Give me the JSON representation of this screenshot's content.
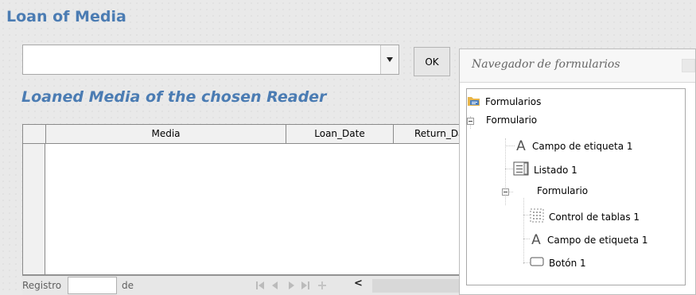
{
  "form": {
    "title": "Loan of Media",
    "ok_label": "OK",
    "subtitle": "Loaned Media of the chosen Reader"
  },
  "grid": {
    "columns": [
      "Media",
      "Loan_Date",
      "Return_Da"
    ]
  },
  "navigation": {
    "record_label": "Registro",
    "of_label": "de",
    "scroll_left_glyph": "<"
  },
  "navigator": {
    "title": "Navegador de formularios",
    "tree": [
      {
        "label": "Formularios",
        "icon": "forms-folder-icon",
        "level": 0
      },
      {
        "label": "Formulario",
        "icon": "expander-icon",
        "level": 0
      },
      {
        "label": "Campo de etiqueta 1",
        "icon": "label-field-icon",
        "level": 1
      },
      {
        "label": "Listado 1",
        "icon": "listbox-icon",
        "level": 1
      },
      {
        "label": "Formulario",
        "icon": "expander-icon",
        "level": 1
      },
      {
        "label": "Control de tablas  1",
        "icon": "table-control-icon",
        "level": 2
      },
      {
        "label": "Campo de etiqueta 1",
        "icon": "label-field-icon",
        "level": 2
      },
      {
        "label": "Botón 1",
        "icon": "button-icon",
        "level": 2
      }
    ]
  },
  "colors": {
    "heading": "#4b7cb3",
    "background": "#e9e9e9"
  }
}
